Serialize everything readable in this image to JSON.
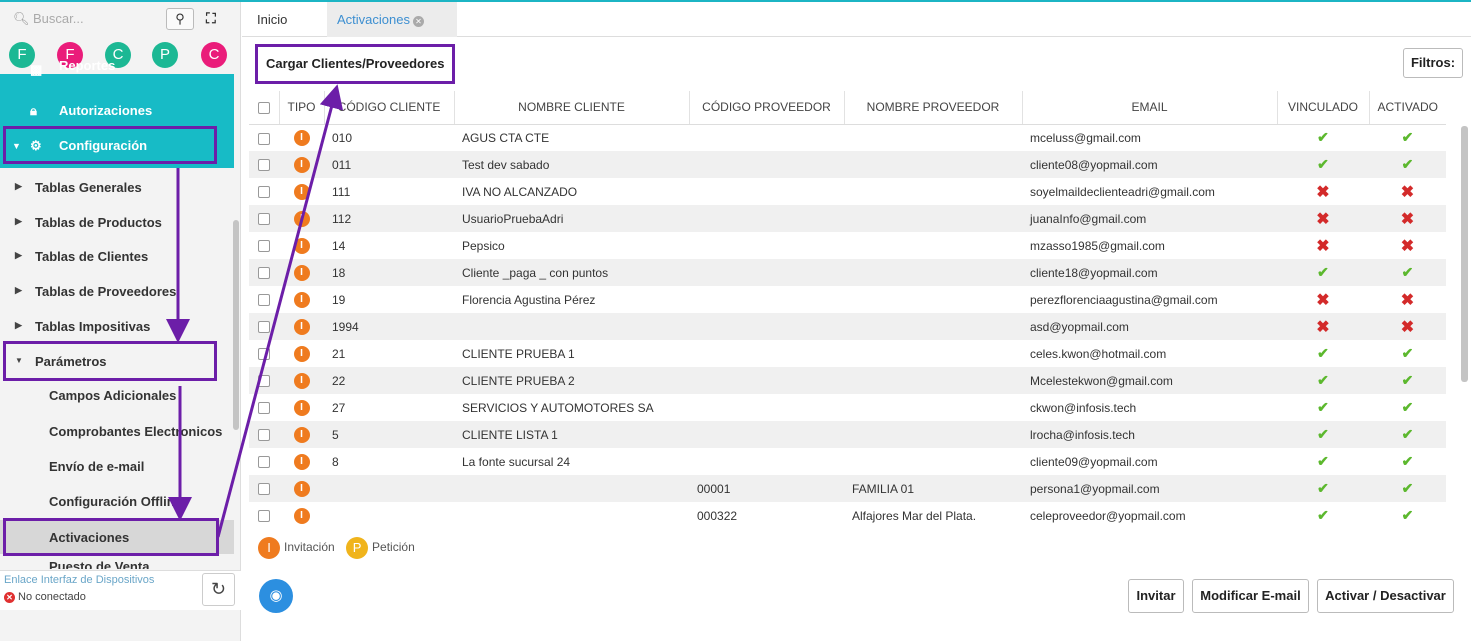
{
  "sidebar": {
    "search_placeholder": "Buscar...",
    "search_button": "🔍",
    "fullscreen_icon": "⛶",
    "circles": [
      {
        "letter": "F",
        "color": "#1cb894"
      },
      {
        "letter": "F",
        "color": "#ea1c7a"
      },
      {
        "letter": "C",
        "color": "#1cb894"
      },
      {
        "letter": "P",
        "color": "#1cb894"
      },
      {
        "letter": "C",
        "color": "#ea1c7a"
      }
    ],
    "teal_items": [
      {
        "label": "Reportes",
        "icon": "chart-icon"
      },
      {
        "label": "Autorizaciones",
        "icon": "lock-icon"
      },
      {
        "label": "Configuración",
        "icon": "gears-icon"
      }
    ],
    "items": [
      {
        "label": "Tablas Generales"
      },
      {
        "label": "Tablas de Productos"
      },
      {
        "label": "Tablas de Clientes"
      },
      {
        "label": "Tablas de Proveedores"
      },
      {
        "label": "Tablas Impositivas"
      },
      {
        "label": "Parámetros"
      }
    ],
    "sub_items": [
      {
        "label": "Campos Adicionales"
      },
      {
        "label": "Comprobantes Electronicos"
      },
      {
        "label": "Envío de e-mail"
      },
      {
        "label": "Configuración Offline"
      },
      {
        "label": "Activaciones"
      },
      {
        "label": "Puesto de Venta"
      }
    ],
    "device_link": "Enlace Interfaz de Dispositivos",
    "device_status": "No conectado"
  },
  "tabs": {
    "inicio": "Inicio",
    "activaciones": "Activaciones"
  },
  "main": {
    "load_button": "Cargar Clientes/Proveedores",
    "filters_button": "Filtros:",
    "columns": [
      "TIPO",
      "CÓDIGO CLIENTE",
      "NOMBRE CLIENTE",
      "CÓDIGO PROVEEDOR",
      "NOMBRE PROVEEDOR",
      "EMAIL",
      "VINCULADO",
      "ACTIVADO"
    ],
    "rows": [
      {
        "tipo": "I",
        "cod_cli": "010",
        "nom_cli": "AGUS CTA CTE",
        "cod_prov": "",
        "nom_prov": "",
        "email": "mceluss@gmail.com",
        "vinculado": true,
        "activado": true
      },
      {
        "tipo": "I",
        "cod_cli": "011",
        "nom_cli": "Test dev sabado",
        "cod_prov": "",
        "nom_prov": "",
        "email": "cliente08@yopmail.com",
        "vinculado": true,
        "activado": true
      },
      {
        "tipo": "I",
        "cod_cli": "111",
        "nom_cli": "IVA NO ALCANZADO",
        "cod_prov": "",
        "nom_prov": "",
        "email": "soyelmaildeclienteadri@gmail.com",
        "vinculado": false,
        "activado": false
      },
      {
        "tipo": "I",
        "cod_cli": "112",
        "nom_cli": "UsuarioPruebaAdri",
        "cod_prov": "",
        "nom_prov": "",
        "email": "juanaInfo@gmail.com",
        "vinculado": false,
        "activado": false
      },
      {
        "tipo": "I",
        "cod_cli": "14",
        "nom_cli": "Pepsico",
        "cod_prov": "",
        "nom_prov": "",
        "email": "mzasso1985@gmail.com",
        "vinculado": false,
        "activado": false
      },
      {
        "tipo": "I",
        "cod_cli": "18",
        "nom_cli": "Cliente _paga _ con puntos",
        "cod_prov": "",
        "nom_prov": "",
        "email": "cliente18@yopmail.com",
        "vinculado": true,
        "activado": true
      },
      {
        "tipo": "I",
        "cod_cli": "19",
        "nom_cli": "Florencia Agustina Pérez",
        "cod_prov": "",
        "nom_prov": "",
        "email": "perezflorenciaagustina@gmail.com",
        "vinculado": false,
        "activado": false
      },
      {
        "tipo": "I",
        "cod_cli": "1994",
        "nom_cli": "",
        "cod_prov": "",
        "nom_prov": "",
        "email": "asd@yopmail.com",
        "vinculado": false,
        "activado": false
      },
      {
        "tipo": "I",
        "cod_cli": "21",
        "nom_cli": "CLIENTE PRUEBA 1",
        "cod_prov": "",
        "nom_prov": "",
        "email": "celes.kwon@hotmail.com",
        "vinculado": true,
        "activado": true
      },
      {
        "tipo": "I",
        "cod_cli": "22",
        "nom_cli": "CLIENTE PRUEBA 2",
        "cod_prov": "",
        "nom_prov": "",
        "email": "Mcelestekwon@gmail.com",
        "vinculado": true,
        "activado": true
      },
      {
        "tipo": "I",
        "cod_cli": "27",
        "nom_cli": "SERVICIOS Y AUTOMOTORES SA",
        "cod_prov": "",
        "nom_prov": "",
        "email": "ckwon@infosis.tech",
        "vinculado": true,
        "activado": true
      },
      {
        "tipo": "I",
        "cod_cli": "5",
        "nom_cli": "CLIENTE LISTA 1",
        "cod_prov": "",
        "nom_prov": "",
        "email": "lrocha@infosis.tech",
        "vinculado": true,
        "activado": true
      },
      {
        "tipo": "I",
        "cod_cli": "8",
        "nom_cli": "La fonte sucursal 24",
        "cod_prov": "",
        "nom_prov": "",
        "email": "cliente09@yopmail.com",
        "vinculado": true,
        "activado": true
      },
      {
        "tipo": "I",
        "cod_cli": "",
        "nom_cli": "",
        "cod_prov": "00001",
        "nom_prov": "FAMILIA 01",
        "email": "persona1@yopmail.com",
        "vinculado": true,
        "activado": true
      },
      {
        "tipo": "I",
        "cod_cli": "",
        "nom_cli": "",
        "cod_prov": "000322",
        "nom_prov": "Alfajores Mar del Plata.",
        "email": "celeproveedor@yopmail.com",
        "vinculado": true,
        "activado": true
      }
    ],
    "legend": [
      {
        "letter": "I",
        "label": "Invitación",
        "color": "#ef7b1f"
      },
      {
        "letter": "P",
        "label": "Petición",
        "color": "#f0b41c"
      }
    ],
    "buttons": {
      "invite": "Invitar",
      "modify_email": "Modificar E-mail",
      "toggle": "Activar / Desactivar"
    }
  }
}
